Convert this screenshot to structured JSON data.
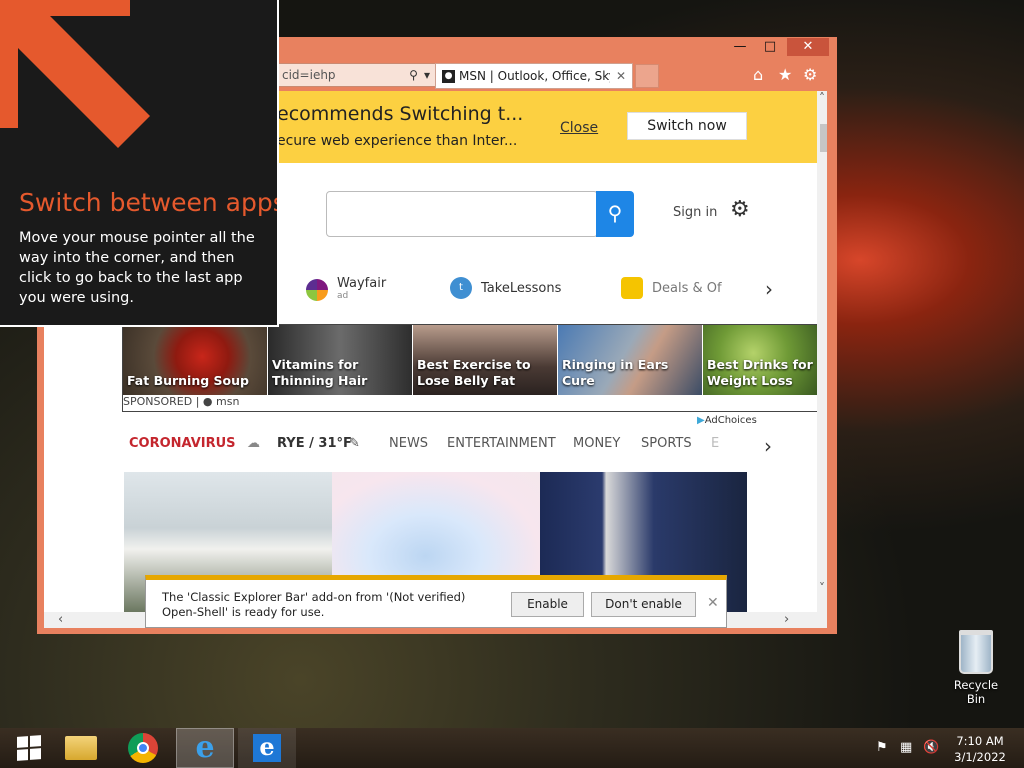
{
  "browser": {
    "address_fragment": "cid=iehp",
    "tab_title": "MSN | Outlook, Office, Sky...",
    "tab_favicon": "msn-icon",
    "title_controls": [
      "minimize-icon",
      "maximize-icon",
      "close-icon"
    ],
    "toolbar_icons": [
      "home-icon",
      "favorites-star-icon",
      "gear-icon"
    ]
  },
  "banner": {
    "title": "ecommends Switching t...",
    "subtitle": "ecure web experience than Inter...",
    "close_label": "Close",
    "switch_label": "Switch now"
  },
  "msn": {
    "search_placeholder": "",
    "sign_in": "Sign in",
    "quick_links": [
      {
        "label": "Wayfair",
        "sub": "ad",
        "icon": "wayfair-icon"
      },
      {
        "label": "TakeLessons",
        "icon": "takelessons-icon"
      },
      {
        "label": "Deals & Of",
        "icon": "deals-tag-icon"
      }
    ],
    "sponsored_tiles": [
      {
        "label": "Fat Burning Soup"
      },
      {
        "label": "Vitamins for Thinning Hair"
      },
      {
        "label": "Best Exercise to Lose Belly Fat"
      },
      {
        "label": "Ringing in Ears Cure"
      },
      {
        "label": "Best Drinks for Weight Loss"
      }
    ],
    "sponsored_label": "SPONSORED |",
    "sponsor_brand": "msn",
    "adchoices": "AdChoices",
    "nav": {
      "coronavirus": "CORONAVIRUS",
      "weather": "RYE / 31°F",
      "items": [
        "NEWS",
        "ENTERTAINMENT",
        "MONEY",
        "SPORTS",
        "E"
      ]
    }
  },
  "tip": {
    "title": "Switch between apps",
    "body": "Move your mouse pointer all the way into the corner, and then click to go back to the last app you were using."
  },
  "notification": {
    "text": "The 'Classic Explorer Bar' add-on from '(Not verified) Open-Shell' is ready for use.",
    "enable": "Enable",
    "dont_enable": "Don't enable"
  },
  "desktop": {
    "recycle_bin": "Recycle Bin"
  },
  "taskbar": {
    "apps": [
      "start-icon",
      "file-explorer-icon",
      "chrome-icon",
      "internet-explorer-icon",
      "internet-explorer-metro-icon"
    ],
    "time": "7:10 AM",
    "date": "3/1/2022"
  },
  "colors": {
    "ie_frame": "#e8815f",
    "banner": "#fcd041",
    "search_button": "#1e86e6",
    "tip_accent": "#e5592d",
    "coronavirus": "#c4262e"
  }
}
